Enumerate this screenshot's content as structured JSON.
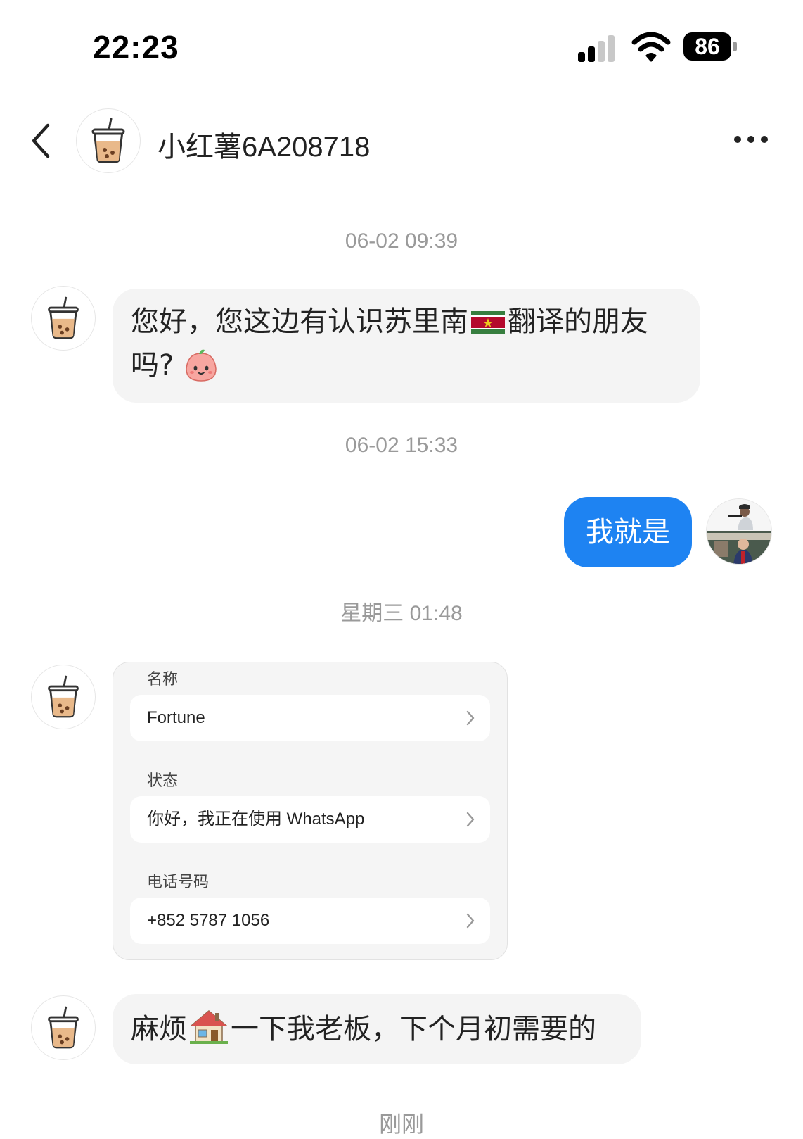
{
  "status_bar": {
    "time": "22:23",
    "battery": "86"
  },
  "header": {
    "contact_name": "小红薯6A208718"
  },
  "messages": {
    "ts1": "06-02 09:39",
    "msg1_part1": "您好，您这边有认识苏里南",
    "msg1_part2": "翻译的朋友",
    "msg1_part3": "吗?",
    "ts2": "06-02 15:33",
    "msg2": "我就是",
    "ts3": "星期三 01:48",
    "ts4": "刚刚",
    "msg3_part1": "麻烦",
    "msg3_part2": "一下我老板，下个月初需要的"
  },
  "contact_card": {
    "name_label": "名称",
    "name_value": "Fortune",
    "status_label": "状态",
    "status_value": "你好，我正在使用 WhatsApp",
    "phone_label": "电话号码",
    "phone_value": "+852 5787 1056"
  },
  "icons": [
    "back-chevron-icon",
    "more-dots-icon",
    "signal-icon",
    "wifi-icon",
    "battery-icon",
    "bubble-tea-avatar-icon",
    "suriname-flag-icon",
    "happy-face-emoji-icon",
    "house-emoji-icon",
    "chevron-right-icon"
  ],
  "colors": {
    "outgoing_bubble": "#1e83f2",
    "incoming_bubble": "#f4f4f4",
    "timestamp": "#9a9a9a"
  }
}
